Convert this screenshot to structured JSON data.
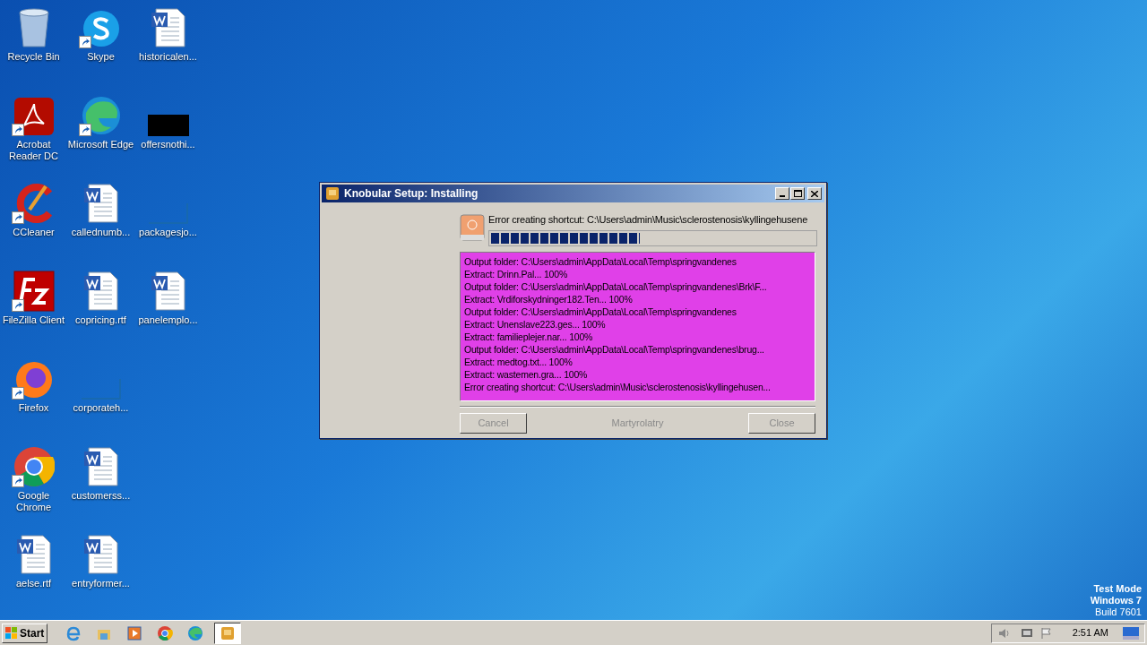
{
  "desktop": {
    "icons": [
      {
        "label": "Recycle Bin",
        "kind": "recycle",
        "shortcut": false
      },
      {
        "label": "Acrobat Reader DC",
        "kind": "acrobat",
        "shortcut": true
      },
      {
        "label": "CCleaner",
        "kind": "ccleaner",
        "shortcut": true
      },
      {
        "label": "FileZilla Client",
        "kind": "filezilla",
        "shortcut": true
      },
      {
        "label": "Firefox",
        "kind": "firefox",
        "shortcut": true
      },
      {
        "label": "Google Chrome",
        "kind": "chrome",
        "shortcut": true
      },
      {
        "label": "aelse.rtf",
        "kind": "word",
        "shortcut": false
      },
      {
        "label": "Skype",
        "kind": "skype",
        "shortcut": true
      },
      {
        "label": "Microsoft Edge",
        "kind": "edge",
        "shortcut": true
      },
      {
        "label": "callednumb...",
        "kind": "word",
        "shortcut": false
      },
      {
        "label": "copricing.rtf",
        "kind": "word",
        "shortcut": false
      },
      {
        "label": "corporateh...",
        "kind": "blank",
        "shortcut": false
      },
      {
        "label": "customerss...",
        "kind": "word",
        "shortcut": false
      },
      {
        "label": "entryformer...",
        "kind": "word",
        "shortcut": false
      },
      {
        "label": "historicalen...",
        "kind": "word",
        "shortcut": false
      },
      {
        "label": "offersnothi...",
        "kind": "black",
        "shortcut": false
      },
      {
        "label": "packagesjo...",
        "kind": "blank",
        "shortcut": false
      },
      {
        "label": "panelemplo...",
        "kind": "word",
        "shortcut": false
      }
    ],
    "watermark_lines": [
      "Test Mode",
      "Windows 7",
      "Build 7601"
    ]
  },
  "dialog": {
    "title": "Knobular Setup: Installing",
    "status": "Error creating shortcut: C:\\Users\\admin\\Music\\sclerostenosis\\kyllingehusene",
    "progress": {
      "level": 0.46
    },
    "log": [
      "Output folder: C:\\Users\\admin\\AppData\\Local\\Temp\\springvandenes",
      "Extract: Drinn.Pal... 100%",
      "Output folder: C:\\Users\\admin\\AppData\\Local\\Temp\\springvandenes\\Brk\\F...",
      "Extract: Vrdiforskydninger182.Ten... 100%",
      "Output folder: C:\\Users\\admin\\AppData\\Local\\Temp\\springvandenes",
      "Extract: Unenslave223.ges... 100%",
      "Extract: familieplejer.nar... 100%",
      "Output folder: C:\\Users\\admin\\AppData\\Local\\Temp\\springvandenes\\brug...",
      "Extract: medtog.txt... 100%",
      "Extract: wastemen.gra... 100%",
      "Error creating shortcut: C:\\Users\\admin\\Music\\sclerostenosis\\kyllingehusen..."
    ],
    "buttons": [
      {
        "label": "Cancel",
        "disabled": true
      },
      {
        "label": "Close",
        "disabled": true
      }
    ],
    "branding": "Martyrolatry"
  },
  "taskbar": {
    "start": "Start",
    "apps": [
      {
        "kind": "ie",
        "selected": false
      },
      {
        "kind": "explorer",
        "selected": false
      },
      {
        "kind": "media",
        "selected": false
      },
      {
        "kind": "chrome",
        "selected": false
      },
      {
        "kind": "edge",
        "selected": false
      },
      {
        "kind": "setup",
        "selected": true
      }
    ],
    "clock": "2:51 AM"
  }
}
